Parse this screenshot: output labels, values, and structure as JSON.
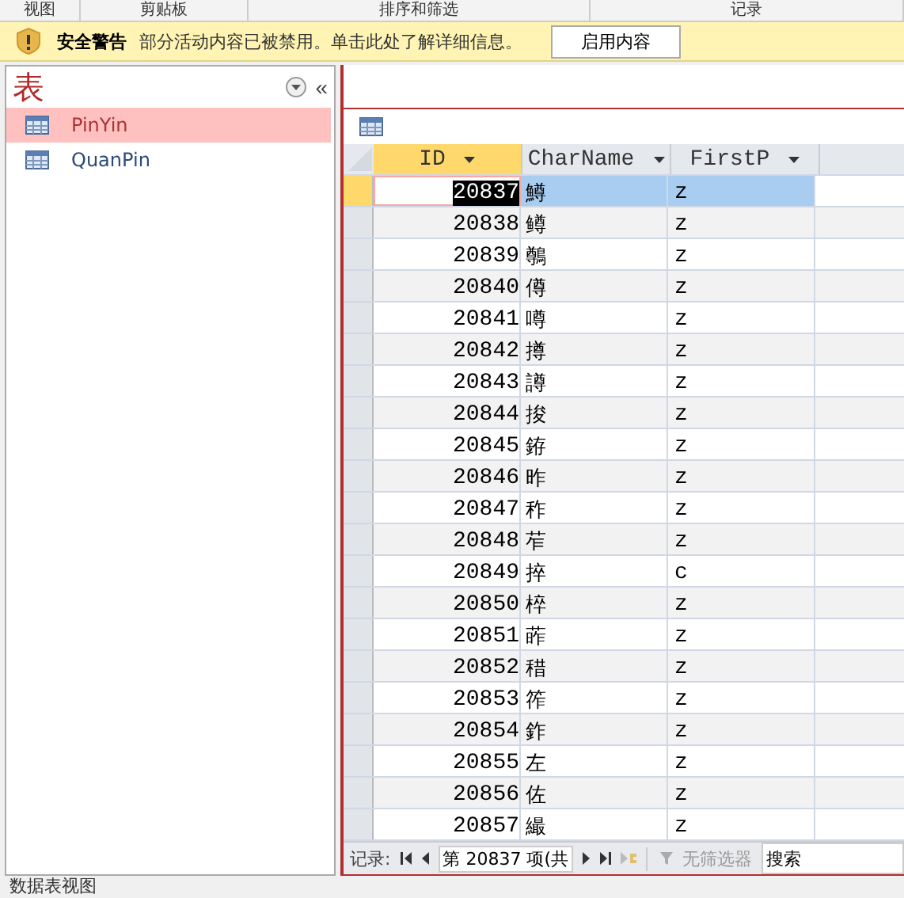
{
  "ribbon_groups": [
    "视图",
    "剪贴板",
    "排序和筛选",
    "记录"
  ],
  "security_warning": {
    "title": "安全警告",
    "message": "部分活动内容已被禁用。单击此处了解详细信息。",
    "button": "启用内容"
  },
  "nav_pane": {
    "title": "表",
    "collapse": "«",
    "items": [
      {
        "label": "PinYin",
        "selected": true
      },
      {
        "label": "QuanPin",
        "selected": false
      }
    ]
  },
  "table": {
    "columns": [
      "ID",
      "CharName",
      "FirstP"
    ],
    "rows": [
      {
        "id": "20837",
        "char": "鱒",
        "first": "z",
        "selected": true
      },
      {
        "id": "20838",
        "char": "鳟",
        "first": "z",
        "selected": false
      },
      {
        "id": "20839",
        "char": "鷷",
        "first": "z",
        "selected": false
      },
      {
        "id": "20840",
        "char": "僔",
        "first": "z",
        "selected": false
      },
      {
        "id": "20841",
        "char": "噂",
        "first": "z",
        "selected": false
      },
      {
        "id": "20842",
        "char": "撙",
        "first": "z",
        "selected": false
      },
      {
        "id": "20843",
        "char": "譐",
        "first": "z",
        "selected": false
      },
      {
        "id": "20844",
        "char": "捘",
        "first": "z",
        "selected": false
      },
      {
        "id": "20845",
        "char": "銌",
        "first": "z",
        "selected": false
      },
      {
        "id": "20846",
        "char": "昨",
        "first": "z",
        "selected": false
      },
      {
        "id": "20847",
        "char": "秨",
        "first": "z",
        "selected": false
      },
      {
        "id": "20848",
        "char": "苲",
        "first": "z",
        "selected": false
      },
      {
        "id": "20849",
        "char": "捽",
        "first": "c",
        "selected": false
      },
      {
        "id": "20850",
        "char": "椊",
        "first": "z",
        "selected": false
      },
      {
        "id": "20851",
        "char": "葃",
        "first": "z",
        "selected": false
      },
      {
        "id": "20852",
        "char": "稓",
        "first": "z",
        "selected": false
      },
      {
        "id": "20853",
        "char": "筰",
        "first": "z",
        "selected": false
      },
      {
        "id": "20854",
        "char": "鈼",
        "first": "z",
        "selected": false
      },
      {
        "id": "20855",
        "char": "左",
        "first": "z",
        "selected": false
      },
      {
        "id": "20856",
        "char": "佐",
        "first": "z",
        "selected": false
      },
      {
        "id": "20857",
        "char": "繓",
        "first": "z",
        "selected": false
      }
    ]
  },
  "record_nav": {
    "label": "记录:",
    "position": "第 20837 项(共",
    "filter": "无筛选器",
    "search_placeholder": "搜索"
  },
  "status_bar": "数据表视图"
}
